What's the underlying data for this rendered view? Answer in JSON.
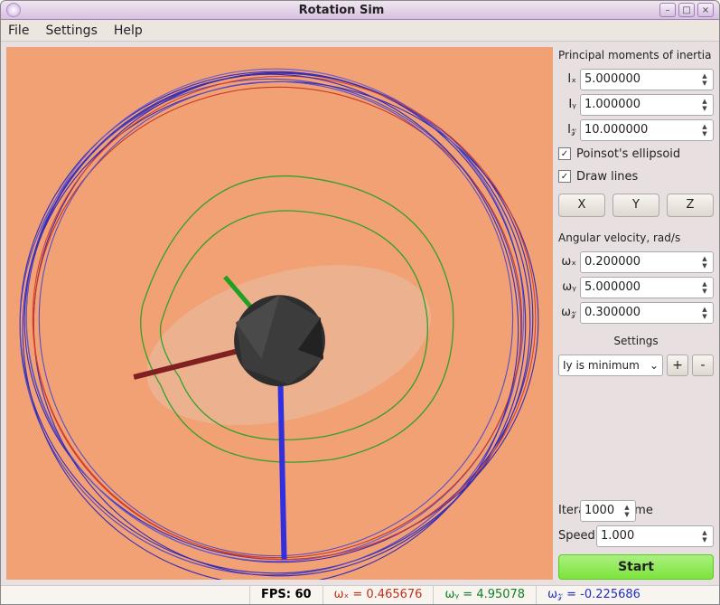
{
  "window": {
    "title": "Rotation Sim",
    "icon": "app-icon"
  },
  "menu": {
    "file": "File",
    "settings": "Settings",
    "help": "Help"
  },
  "sidebar": {
    "inertia_header": "Principal moments of inertia",
    "ix_label": "Iₓ",
    "iy_label": "Iᵧ",
    "iz_label": "I𝓏",
    "ix": "5.000000",
    "iy": "1.000000",
    "iz": "10.000000",
    "poinsot_label": "Poinsot's ellipsoid",
    "poinsot_checked": "✓",
    "drawlines_label": "Draw lines",
    "drawlines_checked": "✓",
    "btn_x": "X",
    "btn_y": "Y",
    "btn_z": "Z",
    "angvel_header": "Angular velocity, rad/s",
    "wx_label": "ωₓ",
    "wy_label": "ωᵧ",
    "wz_label": "ω𝓏",
    "wx": "0.200000",
    "wy": "5.000000",
    "wz": "0.300000",
    "settings_header": "Settings",
    "settings_select": "Iy is minimum",
    "plus": "+",
    "minus": "-",
    "iterations_label": "Iterations/frame",
    "iterations": "1000",
    "speed_label": "Speed",
    "speed": "1.000",
    "start": "Start"
  },
  "status": {
    "fps_label": "FPS: 60",
    "wx": "ωₓ = 0.465676",
    "wy": "ωᵧ = 4.95078",
    "wz": "ω𝓏 = -0.225686"
  },
  "viewport": {
    "bgcolor": "#f2a175",
    "sphere_color": "#3a3a3a",
    "ellipsoid_color": "#e9b89a",
    "axis_x_color": "#802020",
    "axis_y_color": "#20a020",
    "axis_z_color": "#3030e0",
    "trace_red": "#d03020",
    "trace_blue": "#1818c0",
    "trace_green": "#20a020"
  }
}
